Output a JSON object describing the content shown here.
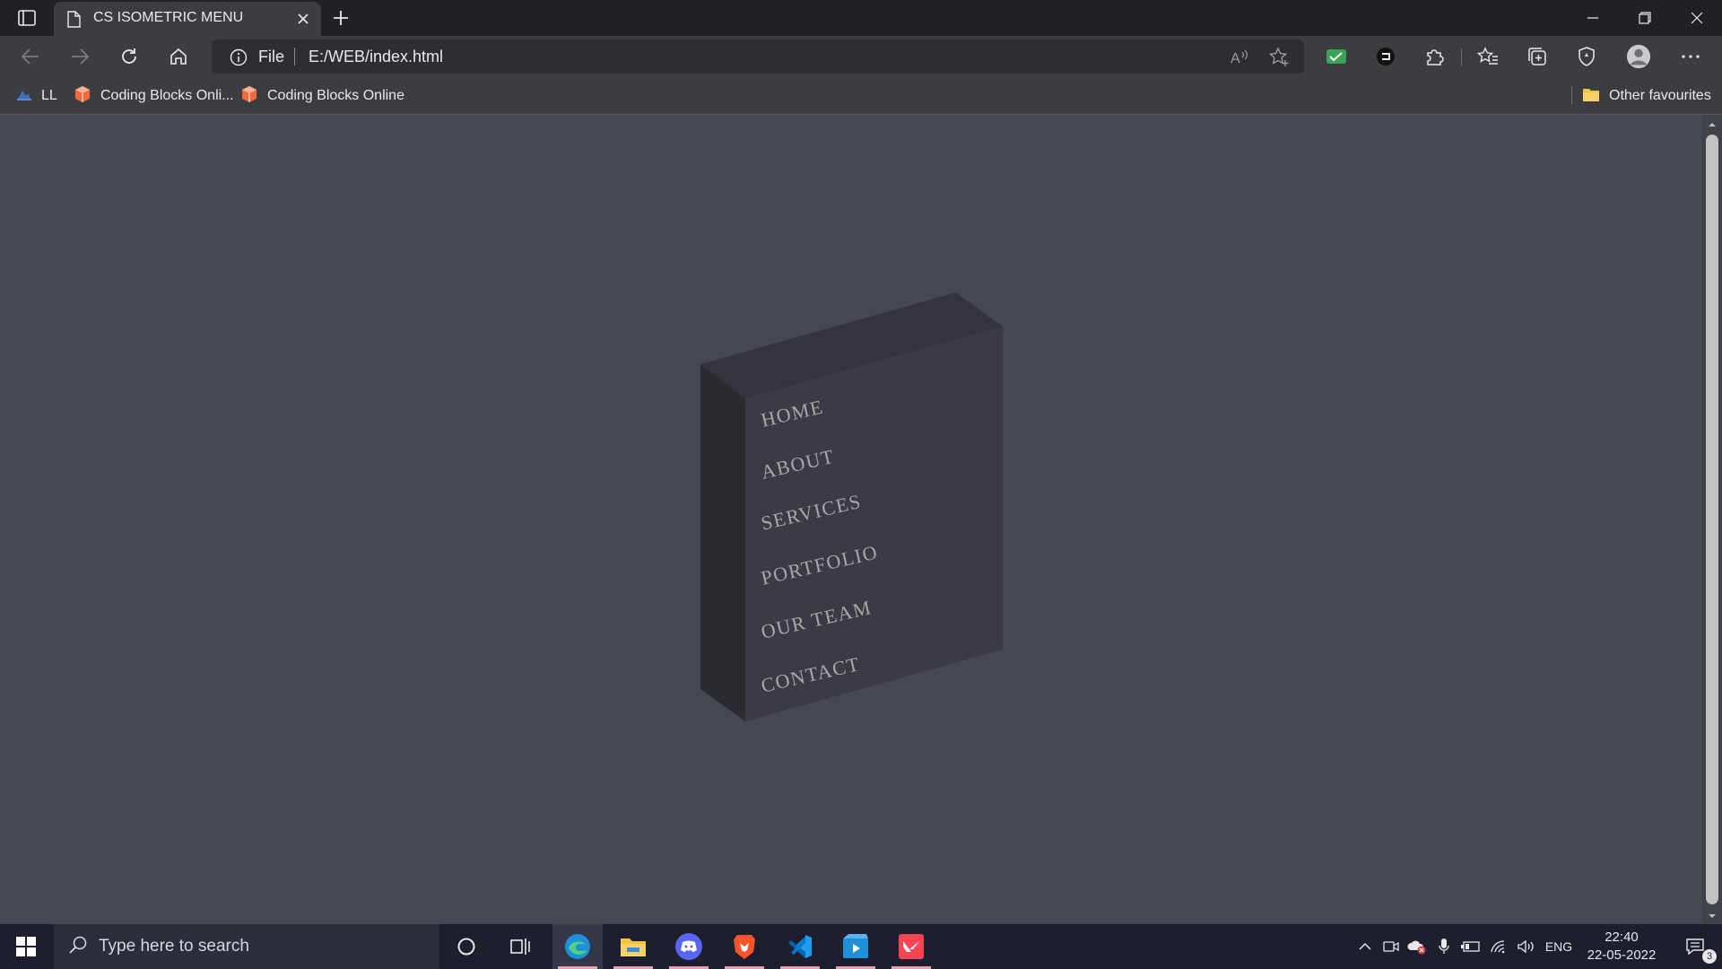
{
  "tab": {
    "title": "CS ISOMETRIC MENU"
  },
  "address_bar": {
    "scheme_label": "File",
    "url": "E:/WEB/index.html"
  },
  "bookmarks": [
    {
      "label": "LL"
    },
    {
      "label": "Coding Blocks Onli..."
    },
    {
      "label": "Coding Blocks Online"
    }
  ],
  "other_favourites": "Other favourites",
  "menu": {
    "items": [
      "HOME",
      "ABOUT",
      "SERVICES",
      "PORTFOLIO",
      "OUR TEAM",
      "CONTACT"
    ]
  },
  "taskbar": {
    "search_placeholder": "Type here to search",
    "language": "ENG",
    "time": "22:40",
    "date": "22-05-2022",
    "notification_count": "3"
  },
  "colors": {
    "page_bg": "#444850",
    "box_front": "#3b3b43",
    "box_top": "#34353c",
    "box_side": "#2b2c31",
    "menu_text": "#a7a7ab"
  }
}
